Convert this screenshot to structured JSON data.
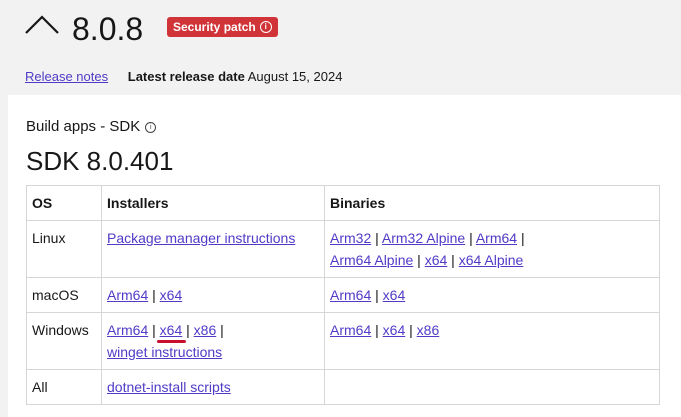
{
  "header": {
    "version": "8.0.8",
    "badge_label": "Security patch",
    "release_notes_link": "Release notes",
    "latest_release_label": "Latest release date",
    "latest_release_date": "August 15, 2024"
  },
  "sdk": {
    "section_title": "Build apps - SDK",
    "title": "SDK 8.0.401",
    "columns": [
      "OS",
      "Installers",
      "Binaries"
    ],
    "rows": [
      {
        "os": "Linux",
        "installers": [
          "Package manager instructions"
        ],
        "binaries": [
          "Arm32",
          "Arm32 Alpine",
          "Arm64",
          "Arm64 Alpine",
          "x64",
          "x64 Alpine"
        ]
      },
      {
        "os": "macOS",
        "installers": [
          "Arm64",
          "x64"
        ],
        "binaries": [
          "Arm64",
          "x64"
        ]
      },
      {
        "os": "Windows",
        "installers": [
          "Arm64",
          "x64",
          "x86",
          "winget instructions"
        ],
        "binaries": [
          "Arm64",
          "x64",
          "x86"
        ]
      },
      {
        "os": "All",
        "installers": [
          "dotnet-install scripts"
        ],
        "binaries": []
      }
    ]
  },
  "colors": {
    "link": "#4f3bc7",
    "badge_bg": "#d13438",
    "annotation": "#c8102e"
  }
}
